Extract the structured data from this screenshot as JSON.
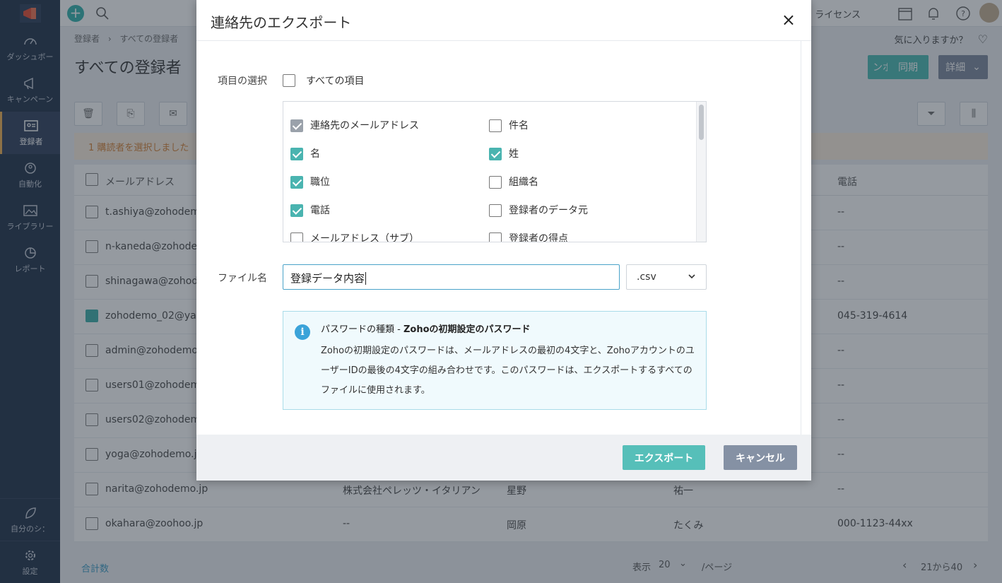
{
  "sidebar": {
    "items": [
      {
        "label": "ダッシュボー"
      },
      {
        "label": "キャンペーン"
      },
      {
        "label": "登録者"
      },
      {
        "label": "自動化"
      },
      {
        "label": "ライブラリー"
      },
      {
        "label": "レポート"
      }
    ],
    "bottom": [
      {
        "label": "自分のシ："
      },
      {
        "label": "設定"
      }
    ]
  },
  "topbar": {
    "license": "ライセンス"
  },
  "page": {
    "breadcrumb_parent": "登録者",
    "breadcrumb_sep": "›",
    "breadcrumb_current": "すべての登録者",
    "title": "すべての登録者",
    "favorite_prompt": "気に入りますか？",
    "import_label": "ンポート",
    "sync_label": "同期",
    "detail_label": "詳細",
    "selected_notice": "1 購読者を選択しました",
    "columns": {
      "email": "メールアドレス",
      "phone": "電話"
    },
    "rows": [
      {
        "email": "t.ashiya@zohodemo",
        "c2": "",
        "c3": "",
        "c4": "",
        "phone": "--",
        "checked": false
      },
      {
        "email": "n-kaneda@zohode",
        "c2": "",
        "c3": "",
        "c4": "",
        "phone": "--",
        "checked": false
      },
      {
        "email": "shinagawa@zohod",
        "c2": "",
        "c3": "",
        "c4": "",
        "phone": "--",
        "checked": false
      },
      {
        "email": "zohodemo_02@ya",
        "c2": "",
        "c3": "",
        "c4": "",
        "phone": "045-319-4614",
        "checked": true
      },
      {
        "email": "admin@zohodemo",
        "c2": "",
        "c3": "",
        "c4": "",
        "phone": "--",
        "checked": false
      },
      {
        "email": "users01@zohodem",
        "c2": "",
        "c3": "",
        "c4": "",
        "phone": "--",
        "checked": false
      },
      {
        "email": "users02@zohodem",
        "c2": "",
        "c3": "",
        "c4": "",
        "phone": "--",
        "checked": false
      },
      {
        "email": "yoga@zohodemo.j",
        "c2": "",
        "c3": "",
        "c4": "",
        "phone": "--",
        "checked": false
      },
      {
        "email": "narita@zohodemo.jp",
        "c2": "株式会社ペレッツ・イタリアン",
        "c3": "星野",
        "c4": "祐一",
        "phone": "--",
        "checked": false
      },
      {
        "email": "okahara@zoohoo.jp",
        "c2": "--",
        "c3": "岡原",
        "c4": "たくみ",
        "phone": "000-1123-44xx",
        "checked": false
      }
    ],
    "footer_total": "合計数",
    "footer_show": "表示",
    "footer_per_page_value": "20",
    "footer_per_page": "/ページ",
    "footer_range": "21から40"
  },
  "modal": {
    "title": "連絡先のエクスポート",
    "close": "×",
    "select_label": "項目の選択",
    "all_fields_label": "すべての項目",
    "fields_left": [
      {
        "label": "連絡先のメールアドレス",
        "state": "locked"
      },
      {
        "label": "名",
        "state": "on"
      },
      {
        "label": "職位",
        "state": "on"
      },
      {
        "label": "電話",
        "state": "on"
      },
      {
        "label": "メールアドレス（サブ）",
        "state": "off"
      }
    ],
    "fields_right": [
      {
        "label": "件名",
        "state": "off"
      },
      {
        "label": "姓",
        "state": "on"
      },
      {
        "label": "組織名",
        "state": "off"
      },
      {
        "label": "登録者のデータ元",
        "state": "off"
      },
      {
        "label": "登録者の得点",
        "state": "off"
      }
    ],
    "filename_label": "ファイル名",
    "filename_value": "登録データ内容",
    "extension": ".csv",
    "info_title_prefix": "パスワードの種類 - ",
    "info_title_bold": "Zohoの初期設定のパスワード",
    "info_body": "Zohoの初期設定のパスワードは、メールアドレスの最初の4文字と、Zohoアカウントのユーザー​IDの最後の4文字の組み合わせです。このパスワードは、エクスポートするすべてのファイルに使用されます。",
    "export_button": "エクスポート",
    "cancel_button": "キャンセル"
  },
  "colors": {
    "accent": "#56bfb9",
    "sidebar": "#2f3e55",
    "info": "#3ba3d9"
  }
}
